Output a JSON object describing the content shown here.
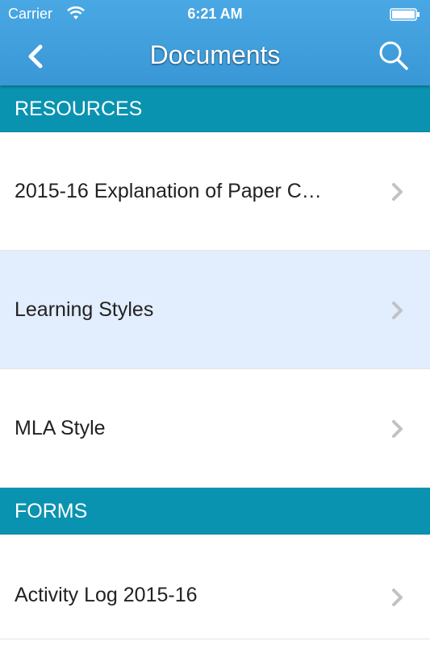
{
  "status_bar": {
    "carrier": "Carrier",
    "time": "6:21 AM"
  },
  "nav": {
    "title": "Documents",
    "back_icon": "chevron-left-icon",
    "search_icon": "search-icon"
  },
  "sections": [
    {
      "header": "RESOURCES",
      "items": [
        {
          "label": "2015-16 Explanation of Paper C…"
        },
        {
          "label": "Learning Styles",
          "highlighted": true
        },
        {
          "label": "MLA Style"
        }
      ]
    },
    {
      "header": "FORMS",
      "items": [
        {
          "label": "Activity Log 2015-16"
        }
      ]
    }
  ],
  "colors": {
    "nav_background": "#3fa0dd",
    "section_header": "#0a93b0",
    "highlight_row": "#e2edfd",
    "chevron": "#c2c2c2"
  }
}
